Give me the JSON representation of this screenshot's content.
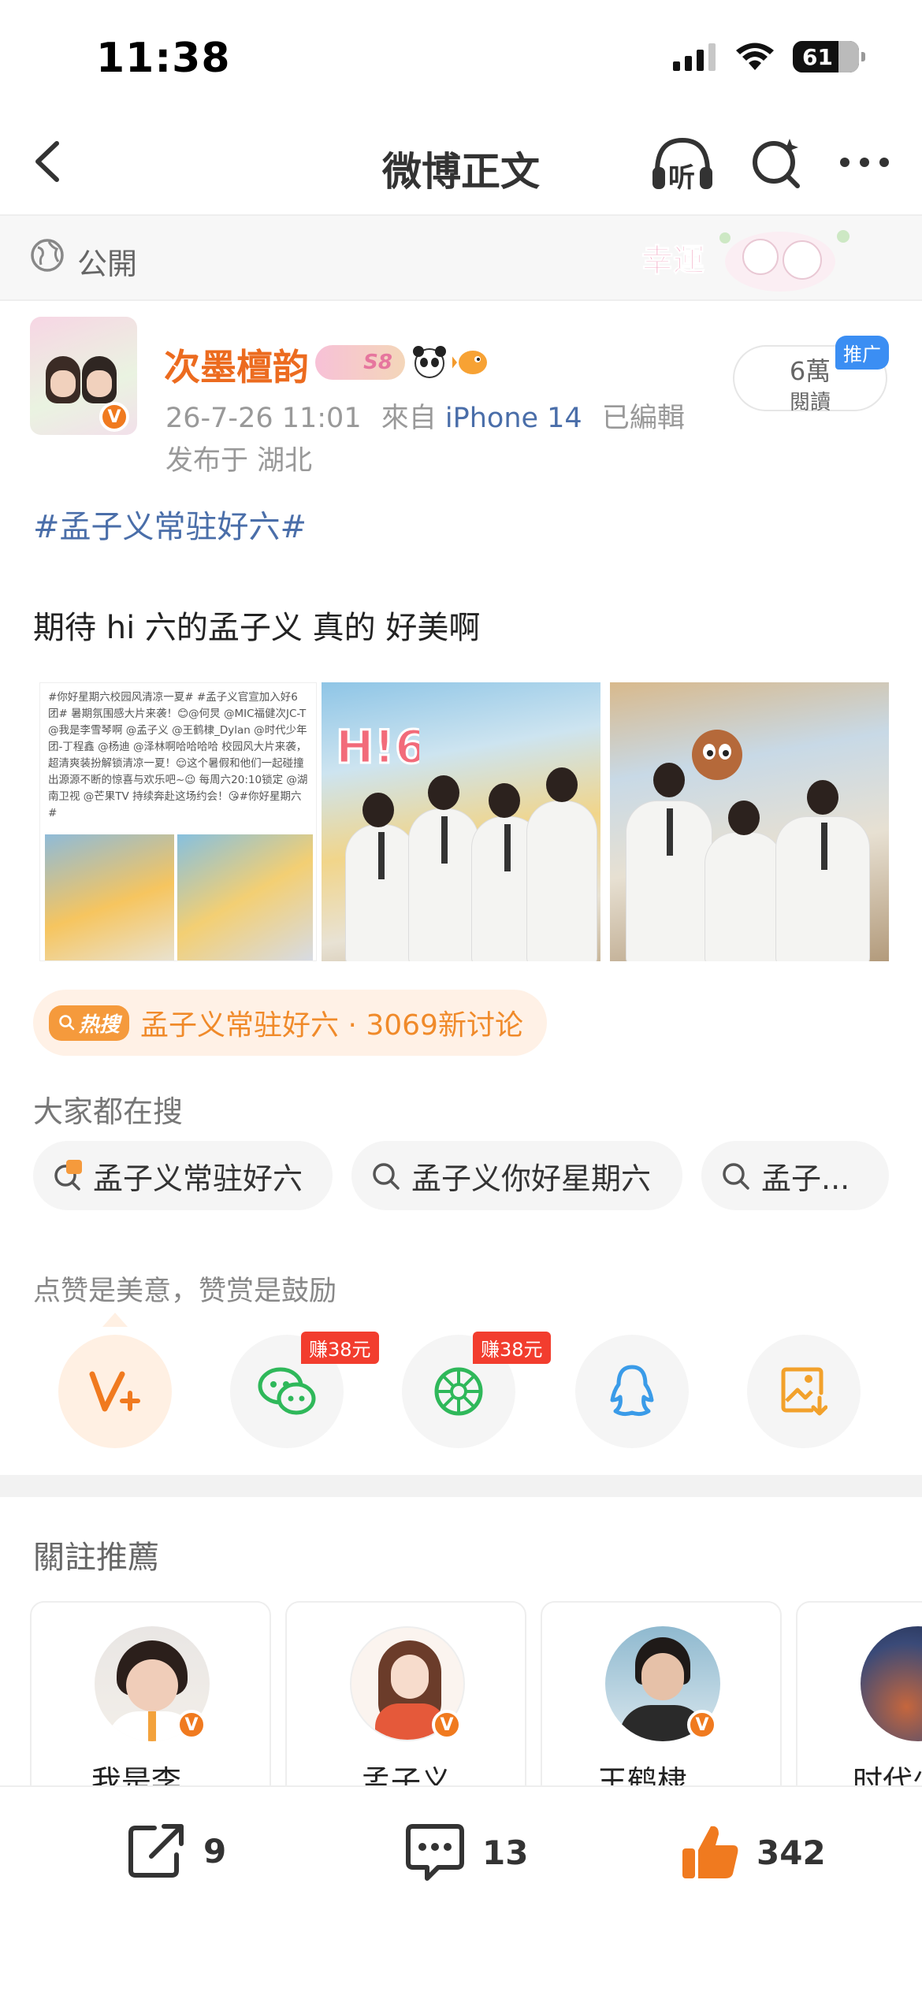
{
  "status_bar": {
    "time": "11:38",
    "battery": "61"
  },
  "nav": {
    "title": "微博正文",
    "listen_label": "听"
  },
  "visibility": {
    "label": "公開"
  },
  "author": {
    "name": "次墨檀韵",
    "level_badge": "S8",
    "time": "26-7-26 11:01",
    "source_prefix": "來自",
    "device": "iPhone 14",
    "edited": "已編輯",
    "location": "发布于 湖北",
    "reads_count": "6萬",
    "reads_label": "閱讀",
    "ad_tag": "推广",
    "verified_icon": "v-badge-icon"
  },
  "post": {
    "hashtag": "#孟子义常驻好六#",
    "text": "期待 hi 六的孟子义 真的 好美啊",
    "image1_text": "#你好星期六校园风清凉一夏# #孟子义官宣加入好6团# 暑期氛围感大片来袭！😊@何炅 @MIC福健次JC-T @我是李雪琴啊 @孟子义 @王鹤棣_Dylan @时代少年团-丁程鑫 @杨迪 @泽林啊哈哈哈哈 校园风大片来袭，超清爽装扮解锁清凉一夏！😌这个暑假和他们一起碰撞出源源不断的惊喜与欢乐吧~😉 每周六20:10锁定 @湖南卫视 @芒果TV 持续奔赴这场约会！😘#你好星期六#"
  },
  "hot_search": {
    "tag": "热搜",
    "text": "孟子义常驻好六 · 3069新讨论"
  },
  "searching": {
    "title": "大家都在搜",
    "chips": [
      "孟子义常驻好六",
      "孟子义你好星期六",
      "孟子..."
    ]
  },
  "tip": {
    "text": "点赞是美意，赞赏是鼓励"
  },
  "share": {
    "earn_wechat": "赚38元",
    "earn_moments": "赚38元",
    "icons": [
      "reward-v-icon",
      "wechat-icon",
      "moments-icon",
      "qq-icon",
      "save-image-icon"
    ]
  },
  "recommend": {
    "title": "關註推薦",
    "users": [
      {
        "name": "我是李..."
      },
      {
        "name": "孟子义"
      },
      {
        "name": "王鹤棣 ..."
      },
      {
        "name": "时代少"
      }
    ]
  },
  "bottom_bar": {
    "repost_count": "9",
    "comment_count": "13",
    "like_count": "342"
  },
  "colors": {
    "accent": "#f07a1f",
    "link": "#4a6ea9",
    "hot": "#f08a2a"
  }
}
